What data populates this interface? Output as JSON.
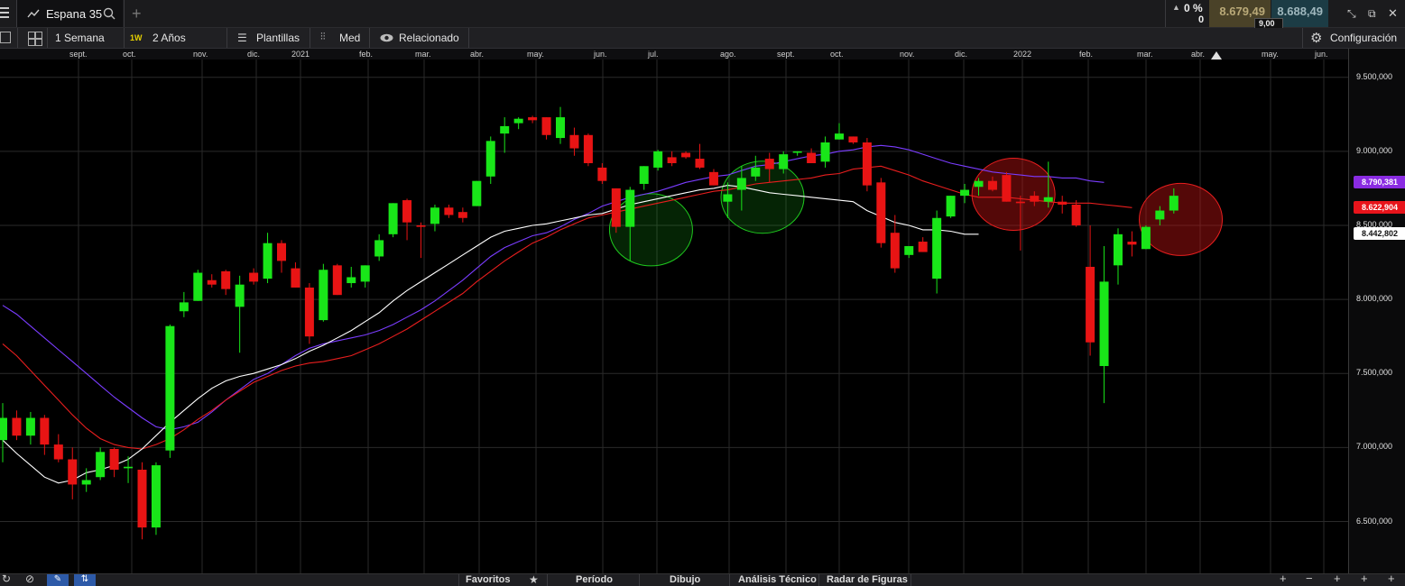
{
  "header": {
    "instrument": "Espana 35",
    "change_pct": "0 %",
    "change_abs": "0",
    "sell_price": "8.679,49",
    "buy_price": "8.688,49",
    "spread": "9,00"
  },
  "toolbar": {
    "period": "1 Semana",
    "interval_badge": "1W",
    "range": "2 Años",
    "templates": "Plantillas",
    "price_type": "Med",
    "related": "Relacionado",
    "settings": "Configuración"
  },
  "months": [
    "sept.",
    "oct.",
    "nov.",
    "dic.",
    "2021",
    "feb.",
    "mar.",
    "abr.",
    "may.",
    "jun.",
    "jul.",
    "ago.",
    "sept.",
    "oct.",
    "nov.",
    "dic.",
    "2022",
    "feb.",
    "mar.",
    "abr.",
    "may.",
    "jun."
  ],
  "y_axis_ticks": [
    "9.500,000",
    "9.000,000",
    "8.500,000",
    "8.000,000",
    "7.500,000",
    "7.000,000",
    "6.500,000"
  ],
  "indicator_labels": [
    {
      "value": "8.790,381",
      "color": "#8a2be2"
    },
    {
      "value": "8.622,904",
      "color": "#e8141b"
    },
    {
      "value": "8.442,802",
      "color": "#ffffff"
    }
  ],
  "bottom_tabs": [
    "Favoritos",
    "Período",
    "Dibujo",
    "Análisis Técnico",
    "Radar de Figuras"
  ],
  "colors": {
    "up": "#19e619",
    "down": "#e81414",
    "ema_slow": "#7a3cff",
    "ema_mid": "#e81e1e",
    "ema_fast": "#ffffff"
  },
  "chart_data": {
    "type": "candlestick",
    "title": "Espana 35 · 1W",
    "ylim": [
      6150,
      9620
    ],
    "candles": [
      {
        "o": 7050,
        "h": 7300,
        "l": 6900,
        "c": 7200
      },
      {
        "o": 7200,
        "h": 7250,
        "l": 7050,
        "c": 7080
      },
      {
        "o": 7080,
        "h": 7240,
        "l": 7020,
        "c": 7200
      },
      {
        "o": 7200,
        "h": 7220,
        "l": 6950,
        "c": 7020
      },
      {
        "o": 7020,
        "h": 7090,
        "l": 6900,
        "c": 6920
      },
      {
        "o": 6920,
        "h": 7000,
        "l": 6650,
        "c": 6750
      },
      {
        "o": 6750,
        "h": 6860,
        "l": 6700,
        "c": 6780
      },
      {
        "o": 6800,
        "h": 7000,
        "l": 6780,
        "c": 6970
      },
      {
        "o": 6990,
        "h": 7000,
        "l": 6800,
        "c": 6850
      },
      {
        "o": 6860,
        "h": 6940,
        "l": 6760,
        "c": 6870
      },
      {
        "o": 6850,
        "h": 6900,
        "l": 6380,
        "c": 6460
      },
      {
        "o": 6460,
        "h": 6900,
        "l": 6410,
        "c": 6880
      },
      {
        "o": 6980,
        "h": 7830,
        "l": 6930,
        "c": 7820
      },
      {
        "o": 7920,
        "h": 8050,
        "l": 7880,
        "c": 7980
      },
      {
        "o": 7990,
        "h": 8200,
        "l": 7990,
        "c": 8180
      },
      {
        "o": 8130,
        "h": 8170,
        "l": 8080,
        "c": 8100
      },
      {
        "o": 8190,
        "h": 8200,
        "l": 8030,
        "c": 8070
      },
      {
        "o": 7950,
        "h": 8160,
        "l": 7640,
        "c": 8100
      },
      {
        "o": 8180,
        "h": 8210,
        "l": 8100,
        "c": 8120
      },
      {
        "o": 8140,
        "h": 8450,
        "l": 8110,
        "c": 8380
      },
      {
        "o": 8380,
        "h": 8400,
        "l": 8180,
        "c": 8260
      },
      {
        "o": 8210,
        "h": 8250,
        "l": 8080,
        "c": 8080
      },
      {
        "o": 8080,
        "h": 8110,
        "l": 7700,
        "c": 7750
      },
      {
        "o": 7860,
        "h": 8240,
        "l": 7850,
        "c": 8200
      },
      {
        "o": 8230,
        "h": 8240,
        "l": 8050,
        "c": 8030
      },
      {
        "o": 8110,
        "h": 8220,
        "l": 8080,
        "c": 8150
      },
      {
        "o": 8120,
        "h": 8230,
        "l": 8080,
        "c": 8230
      },
      {
        "o": 8290,
        "h": 8440,
        "l": 8260,
        "c": 8400
      },
      {
        "o": 8440,
        "h": 8640,
        "l": 8420,
        "c": 8650
      },
      {
        "o": 8670,
        "h": 8680,
        "l": 8400,
        "c": 8520
      },
      {
        "o": 8500,
        "h": 8520,
        "l": 8280,
        "c": 8490
      },
      {
        "o": 8510,
        "h": 8640,
        "l": 8460,
        "c": 8620
      },
      {
        "o": 8620,
        "h": 8640,
        "l": 8550,
        "c": 8570
      },
      {
        "o": 8590,
        "h": 8620,
        "l": 8520,
        "c": 8550
      },
      {
        "o": 8630,
        "h": 8780,
        "l": 8630,
        "c": 8800
      },
      {
        "o": 8830,
        "h": 9100,
        "l": 8780,
        "c": 9070
      },
      {
        "o": 9120,
        "h": 9230,
        "l": 8990,
        "c": 9170
      },
      {
        "o": 9190,
        "h": 9230,
        "l": 9150,
        "c": 9220
      },
      {
        "o": 9230,
        "h": 9240,
        "l": 9190,
        "c": 9210
      },
      {
        "o": 9230,
        "h": 9180,
        "l": 9080,
        "c": 9110
      },
      {
        "o": 9090,
        "h": 9300,
        "l": 9050,
        "c": 9230
      },
      {
        "o": 9110,
        "h": 9160,
        "l": 8970,
        "c": 9020
      },
      {
        "o": 9110,
        "h": 9120,
        "l": 8900,
        "c": 8920
      },
      {
        "o": 8890,
        "h": 8920,
        "l": 8780,
        "c": 8800
      },
      {
        "o": 8750,
        "h": 8740,
        "l": 8450,
        "c": 8490
      },
      {
        "o": 8490,
        "h": 8760,
        "l": 8260,
        "c": 8740
      },
      {
        "o": 8780,
        "h": 8900,
        "l": 8740,
        "c": 8900
      },
      {
        "o": 8890,
        "h": 9010,
        "l": 8870,
        "c": 9000
      },
      {
        "o": 8960,
        "h": 9000,
        "l": 8900,
        "c": 8920
      },
      {
        "o": 8990,
        "h": 9000,
        "l": 8950,
        "c": 8960
      },
      {
        "o": 8950,
        "h": 9050,
        "l": 8880,
        "c": 8890
      },
      {
        "o": 8860,
        "h": 8880,
        "l": 8770,
        "c": 8770
      },
      {
        "o": 8660,
        "h": 8790,
        "l": 8550,
        "c": 8710
      },
      {
        "o": 8740,
        "h": 8900,
        "l": 8600,
        "c": 8820
      },
      {
        "o": 8830,
        "h": 8970,
        "l": 8800,
        "c": 8890
      },
      {
        "o": 8950,
        "h": 8990,
        "l": 8790,
        "c": 8880
      },
      {
        "o": 8880,
        "h": 9000,
        "l": 8850,
        "c": 8980
      },
      {
        "o": 8990,
        "h": 9000,
        "l": 8970,
        "c": 9000
      },
      {
        "o": 8990,
        "h": 9020,
        "l": 8920,
        "c": 8920
      },
      {
        "o": 8930,
        "h": 9100,
        "l": 8890,
        "c": 9060
      },
      {
        "o": 9080,
        "h": 9190,
        "l": 9080,
        "c": 9120
      },
      {
        "o": 9100,
        "h": 9100,
        "l": 9050,
        "c": 9060
      },
      {
        "o": 9060,
        "h": 9090,
        "l": 8730,
        "c": 8770
      },
      {
        "o": 8790,
        "h": 8820,
        "l": 8350,
        "c": 8380
      },
      {
        "o": 8450,
        "h": 8570,
        "l": 8180,
        "c": 8210
      },
      {
        "o": 8300,
        "h": 8350,
        "l": 8280,
        "c": 8360
      },
      {
        "o": 8390,
        "h": 8420,
        "l": 8330,
        "c": 8320
      },
      {
        "o": 8140,
        "h": 8600,
        "l": 8040,
        "c": 8550
      },
      {
        "o": 8560,
        "h": 8700,
        "l": 8550,
        "c": 8700
      },
      {
        "o": 8700,
        "h": 8780,
        "l": 8650,
        "c": 8740
      },
      {
        "o": 8760,
        "h": 8820,
        "l": 8700,
        "c": 8800
      },
      {
        "o": 8800,
        "h": 8830,
        "l": 8730,
        "c": 8740
      },
      {
        "o": 8840,
        "h": 8860,
        "l": 8660,
        "c": 8660
      },
      {
        "o": 8660,
        "h": 8700,
        "l": 8330,
        "c": 8650
      },
      {
        "o": 8700,
        "h": 8730,
        "l": 8630,
        "c": 8660
      },
      {
        "o": 8660,
        "h": 8930,
        "l": 8620,
        "c": 8690
      },
      {
        "o": 8660,
        "h": 8700,
        "l": 8580,
        "c": 8640
      },
      {
        "o": 8640,
        "h": 8670,
        "l": 8490,
        "c": 8500
      },
      {
        "o": 8220,
        "h": 8500,
        "l": 7620,
        "c": 7710
      },
      {
        "o": 7550,
        "h": 8360,
        "l": 7300,
        "c": 8120
      },
      {
        "o": 8230,
        "h": 8480,
        "l": 8100,
        "c": 8440
      },
      {
        "o": 8390,
        "h": 8460,
        "l": 8290,
        "c": 8370
      },
      {
        "o": 8340,
        "h": 8500,
        "l": 8360,
        "c": 8490
      },
      {
        "o": 8540,
        "h": 8630,
        "l": 8500,
        "c": 8600
      },
      {
        "o": 8600,
        "h": 8750,
        "l": 8580,
        "c": 8700
      }
    ],
    "ema_slow": [
      7960,
      7900,
      7820,
      7740,
      7660,
      7580,
      7500,
      7420,
      7340,
      7270,
      7200,
      7140,
      7120,
      7140,
      7170,
      7240,
      7320,
      7390,
      7460,
      7500,
      7560,
      7620,
      7670,
      7700,
      7720,
      7740,
      7760,
      7790,
      7830,
      7880,
      7930,
      7990,
      8060,
      8130,
      8210,
      8290,
      8350,
      8390,
      8430,
      8450,
      8490,
      8540,
      8580,
      8630,
      8660,
      8690,
      8710,
      8730,
      8760,
      8790,
      8810,
      8830,
      8840,
      8870,
      8900,
      8910,
      8930,
      8950,
      8970,
      8980,
      9000,
      9010,
      9030,
      9040,
      9030,
      9010,
      8980,
      8950,
      8920,
      8900,
      8880,
      8860,
      8850,
      8840,
      8830,
      8830,
      8820,
      8820,
      8800,
      8790
    ],
    "ema_mid": [
      7700,
      7620,
      7520,
      7420,
      7320,
      7220,
      7130,
      7060,
      7020,
      7000,
      6990,
      7020,
      7060,
      7120,
      7190,
      7250,
      7320,
      7380,
      7440,
      7480,
      7520,
      7550,
      7570,
      7580,
      7600,
      7620,
      7660,
      7700,
      7750,
      7800,
      7860,
      7920,
      7980,
      8040,
      8120,
      8190,
      8260,
      8320,
      8380,
      8420,
      8470,
      8510,
      8550,
      8570,
      8590,
      8610,
      8630,
      8650,
      8670,
      8690,
      8710,
      8730,
      8740,
      8760,
      8780,
      8790,
      8800,
      8810,
      8820,
      8840,
      8850,
      8880,
      8890,
      8900,
      8870,
      8840,
      8800,
      8770,
      8740,
      8710,
      8690,
      8690,
      8690,
      8680,
      8670,
      8660,
      8650,
      8650,
      8650,
      8640,
      8630,
      8620
    ],
    "ema_fast": [
      7050,
      6960,
      6880,
      6800,
      6760,
      6780,
      6830,
      6850,
      6880,
      6920,
      6990,
      7080,
      7170,
      7250,
      7330,
      7400,
      7450,
      7480,
      7500,
      7530,
      7560,
      7600,
      7650,
      7690,
      7740,
      7790,
      7850,
      7910,
      7990,
      8060,
      8120,
      8180,
      8240,
      8300,
      8360,
      8420,
      8460,
      8480,
      8500,
      8510,
      8530,
      8550,
      8570,
      8580,
      8610,
      8640,
      8660,
      8680,
      8700,
      8720,
      8740,
      8750,
      8770,
      8760,
      8740,
      8720,
      8710,
      8700,
      8690,
      8680,
      8670,
      8660,
      8600,
      8560,
      8520,
      8500,
      8470,
      8470,
      8460,
      8440,
      8440
    ],
    "highlight_circles": [
      {
        "candle": 46.5,
        "price": 8470,
        "color": "#1ec81e",
        "fill": "rgba(30,200,30,0.18)"
      },
      {
        "candle": 54.5,
        "price": 8690,
        "color": "#1ec81e",
        "fill": "rgba(30,200,30,0.18)"
      },
      {
        "candle": 72.5,
        "price": 8710,
        "color": "#e81e1e",
        "fill": "rgba(200,20,20,0.42)"
      },
      {
        "candle": 84.5,
        "price": 8540,
        "color": "#e81e1e",
        "fill": "rgba(200,20,20,0.42)"
      }
    ]
  }
}
